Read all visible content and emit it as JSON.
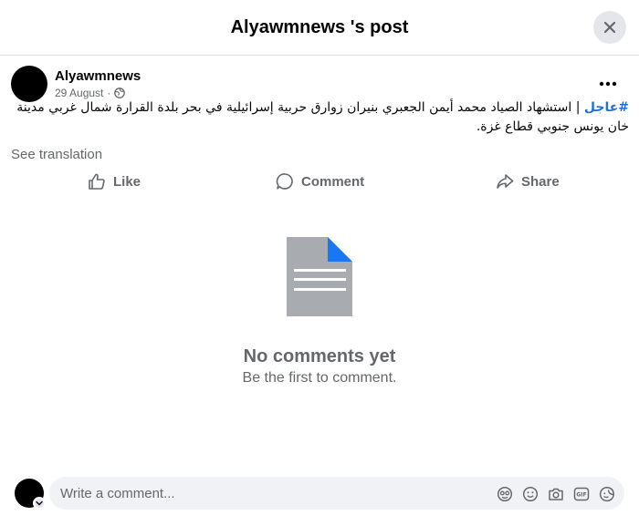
{
  "dialog": {
    "title": "Alyawmnews 's post",
    "close_icon": "close-icon"
  },
  "post": {
    "author": "Alyawmnews",
    "date": "29 August",
    "date_separator": "·",
    "privacy_icon": "globe-icon",
    "hashtag": "#عاجل",
    "body": " | استشهاد الصياد محمد أيمن الجعبري بنيران زوارق حربية إسرائيلية في بحر بلدة القرارة شمال غربي مدينة خان يونس جنوبي قطاع غزة.",
    "see_translation": "See translation"
  },
  "actions": {
    "like": "Like",
    "comment": "Comment",
    "share": "Share"
  },
  "empty_state": {
    "title": "No comments yet",
    "subtitle": "Be the first to comment."
  },
  "composer": {
    "placeholder": "Write a comment...",
    "tools": [
      "avatar-sticker-icon",
      "emoji-icon",
      "camera-icon",
      "gif-icon",
      "sticker-icon"
    ]
  },
  "colors": {
    "accent": "#216fdb",
    "secondary_text": "#65676b",
    "document_gray": "#a8abaf",
    "document_fold": "#1877f2"
  }
}
